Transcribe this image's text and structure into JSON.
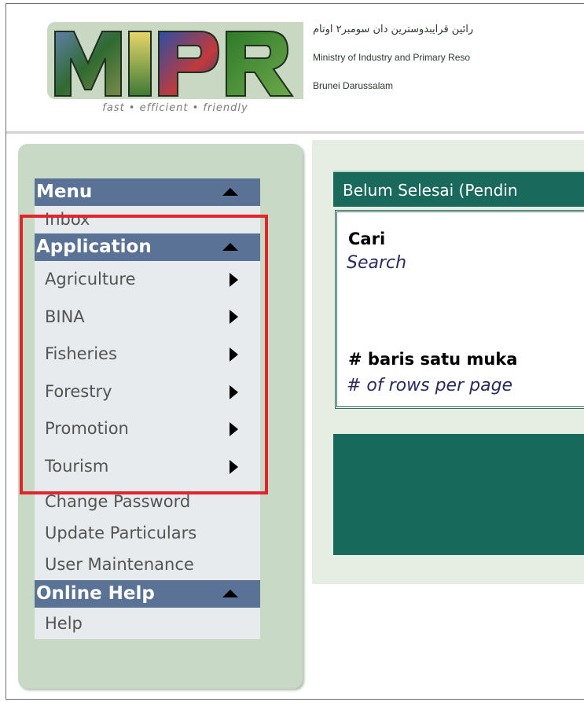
{
  "header": {
    "logo_text": "MIPR",
    "tagline": "fast • efficient • friendly",
    "jawi_line": "رائين قرايبدوسترين دان سومبر٢ اوتام",
    "ministry_name": "Ministry of Industry and Primary Reso",
    "country": "Brunei Darussalam"
  },
  "menu": {
    "menu_header": "Menu",
    "inbox": "Inbox",
    "application_header": "Application",
    "application_items": [
      {
        "label": "Agriculture"
      },
      {
        "label": "BINA"
      },
      {
        "label": "Fisheries"
      },
      {
        "label": "Forestry"
      },
      {
        "label": "Promotion"
      },
      {
        "label": "Tourism"
      }
    ],
    "change_password": "Change Password",
    "update_particulars": "Update Particulars",
    "user_maintenance": "User Maintenance",
    "online_help_header": "Online Help",
    "help": "Help"
  },
  "content": {
    "tab_title": "Belum Selesai (Pendin",
    "search_label_ms": "Cari",
    "search_label_en": "Search",
    "rows_label_ms": "# baris satu muka",
    "rows_label_en": "# of rows per page"
  },
  "colors": {
    "menu_header_bg": "#5a7296",
    "sidebar_bg": "#c8d9c6",
    "teal": "#19695c",
    "highlight": "#e2252b"
  }
}
